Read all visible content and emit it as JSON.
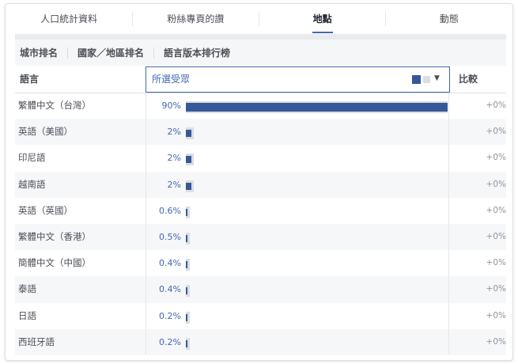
{
  "tabs": [
    {
      "label": "人口統計資料",
      "active": false
    },
    {
      "label": "粉絲專頁的讚",
      "active": false
    },
    {
      "label": "地點",
      "active": true
    },
    {
      "label": "動態",
      "active": false
    }
  ],
  "subtabs": [
    "城市排名",
    "國家／地區排名",
    "語言版本排行榜"
  ],
  "table": {
    "language_header": "語言",
    "selector_label": "所選受眾",
    "compare_header": "比較",
    "rows": [
      {
        "name": "繁體中文（台灣）",
        "percent_text": "90%",
        "percent": 90,
        "compare": "+0%"
      },
      {
        "name": "英語（美國）",
        "percent_text": "2%",
        "percent": 2,
        "compare": "+0%"
      },
      {
        "name": "印尼語",
        "percent_text": "2%",
        "percent": 2,
        "compare": "+0%"
      },
      {
        "name": "越南語",
        "percent_text": "2%",
        "percent": 2,
        "compare": "+0%"
      },
      {
        "name": "英語（英國）",
        "percent_text": "0.6%",
        "percent": 0.6,
        "compare": "+0%"
      },
      {
        "name": "繁體中文（香港）",
        "percent_text": "0.5%",
        "percent": 0.5,
        "compare": "+0%"
      },
      {
        "name": "簡體中文（中國）",
        "percent_text": "0.4%",
        "percent": 0.4,
        "compare": "+0%"
      },
      {
        "name": "泰語",
        "percent_text": "0.4%",
        "percent": 0.4,
        "compare": "+0%"
      },
      {
        "name": "日語",
        "percent_text": "0.2%",
        "percent": 0.2,
        "compare": "+0%"
      },
      {
        "name": "西班牙語",
        "percent_text": "0.2%",
        "percent": 0.2,
        "compare": "+0%"
      }
    ]
  },
  "colors": {
    "accent": "#4267b2",
    "bar": "#365899",
    "bar_ghost": "#dadde1"
  },
  "icons": {
    "selector_swatch_primary": "square",
    "selector_swatch_secondary": "square",
    "selector_dropdown": "caret-down-icon"
  }
}
